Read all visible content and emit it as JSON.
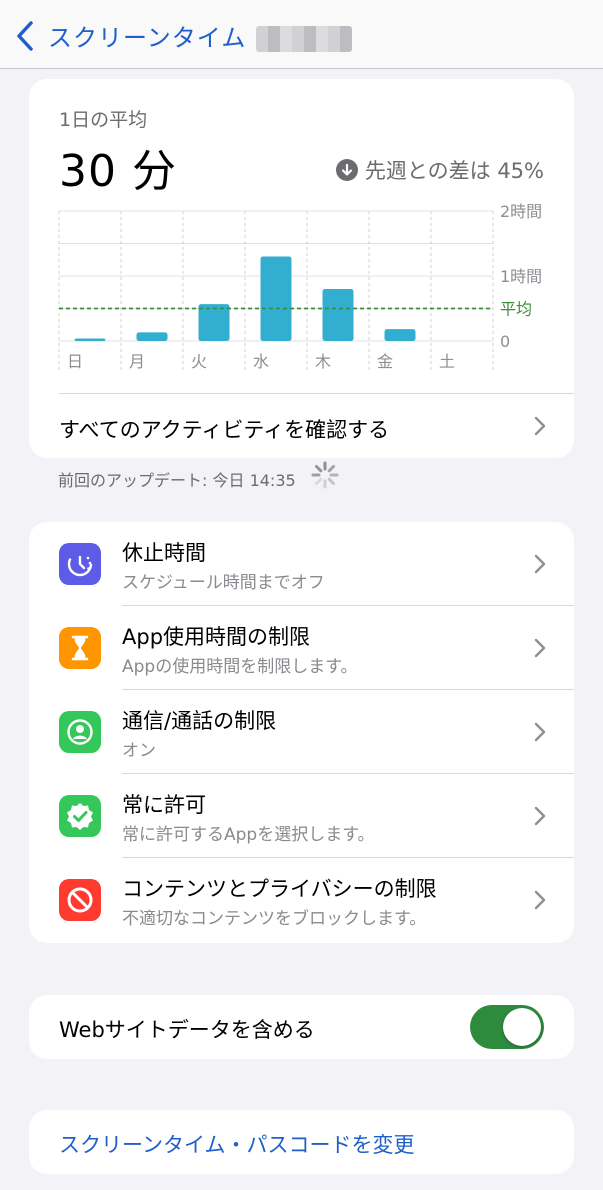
{
  "nav": {
    "back_label": "スクリーンタイム"
  },
  "summary": {
    "avg_label": "1日の平均",
    "avg_value": "30 分",
    "diff_text": "先週との差は 45%"
  },
  "chart_data": {
    "type": "bar",
    "categories": [
      "日",
      "月",
      "火",
      "水",
      "木",
      "金",
      "土"
    ],
    "values": [
      2,
      8,
      34,
      78,
      48,
      11,
      0
    ],
    "unit": "分",
    "ylim": [
      0,
      120
    ],
    "yticks": [
      {
        "label": "2時間",
        "value": 120
      },
      {
        "label": "1時間",
        "value": 60
      },
      {
        "label": "0",
        "value": 0
      }
    ],
    "average": {
      "label": "平均",
      "value": 30
    },
    "bar_color": "#32aed0",
    "avg_color": "#3a8f3a",
    "grid": true
  },
  "activity": {
    "label": "すべてのアクティビティを確認する"
  },
  "update": {
    "text": "前回のアップデート: 今日 14:35"
  },
  "items": [
    {
      "title": "休止時間",
      "subtitle": "スケジュール時間までオフ",
      "icon": "downtime-icon",
      "color": "#5e5ce6"
    },
    {
      "title": "App使用時間の制限",
      "subtitle": "Appの使用時間を制限します。",
      "icon": "hourglass-icon",
      "color": "#ff9500"
    },
    {
      "title": "通信/通話の制限",
      "subtitle": "オン",
      "icon": "contact-icon",
      "color": "#34c759"
    },
    {
      "title": "常に許可",
      "subtitle": "常に許可するAppを選択します。",
      "icon": "checkmark-seal-icon",
      "color": "#34c759"
    },
    {
      "title": "コンテンツとプライバシーの制限",
      "subtitle": "不適切なコンテンツをブロックします。",
      "icon": "prohibited-icon",
      "color": "#ff3b30"
    }
  ],
  "web_toggle": {
    "label": "Webサイトデータを含める",
    "on": true
  },
  "passcode": {
    "label": "スクリーンタイム・パスコードを変更"
  }
}
